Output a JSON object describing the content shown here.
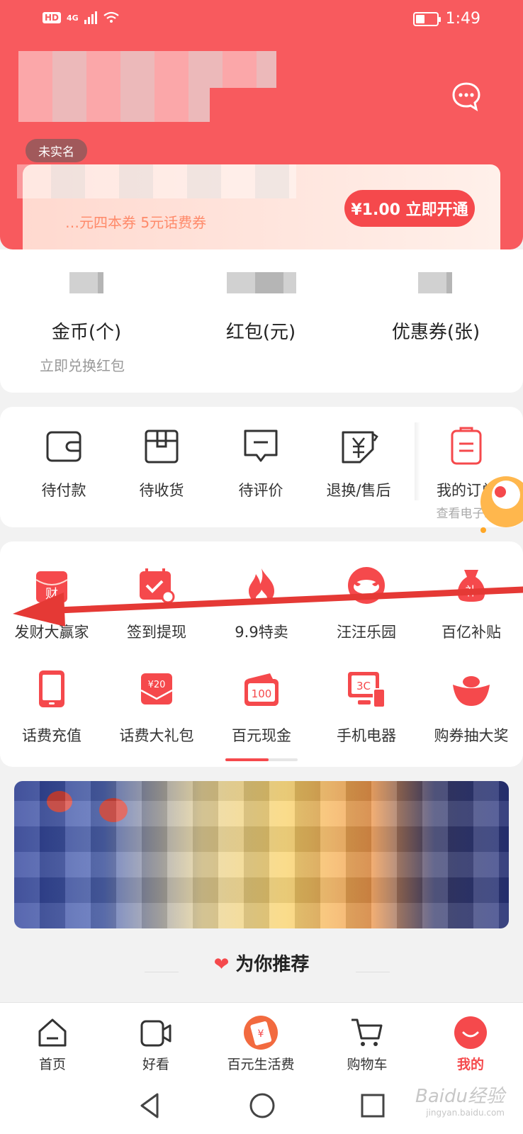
{
  "status_bar": {
    "network": "4G",
    "hd_badge": "HD",
    "time": "1:49"
  },
  "header": {
    "realname_badge": "未实名",
    "vip_subtitle": "…元四本券 5元话费券",
    "open_button": "¥1.00 立即开通"
  },
  "assets": {
    "items": [
      {
        "label": "金币(个)"
      },
      {
        "label": "红包(元)"
      },
      {
        "label": "优惠券(张)"
      }
    ],
    "coins_hint": "立即兑换红包"
  },
  "orders": {
    "items": [
      {
        "label": "待付款",
        "icon": "wallet-icon"
      },
      {
        "label": "待收货",
        "icon": "box-icon"
      },
      {
        "label": "待评价",
        "icon": "comment-icon"
      },
      {
        "label": "退换/售后",
        "icon": "refund-icon"
      },
      {
        "label": "我的订单",
        "icon": "order-list-icon"
      }
    ],
    "my_orders_sub": "查看电子发"
  },
  "services": {
    "items": [
      {
        "label": "发财大赢家",
        "icon": "fortune-icon"
      },
      {
        "label": "签到提现",
        "icon": "calendar-check-icon"
      },
      {
        "label": "9.9特卖",
        "icon": "flame-icon"
      },
      {
        "label": "汪汪乐园",
        "icon": "dog-face-icon"
      },
      {
        "label": "百亿补贴",
        "icon": "money-bag-icon"
      },
      {
        "label": "话费充值",
        "icon": "phone-icon"
      },
      {
        "label": "话费大礼包",
        "icon": "gift-envelope-icon"
      },
      {
        "label": "百元现金",
        "icon": "cash-icon"
      },
      {
        "label": "手机电器",
        "icon": "electronics-icon"
      },
      {
        "label": "购券抽大奖",
        "icon": "gold-ingot-icon"
      }
    ],
    "envelope_value": "¥20",
    "cash_value": "100",
    "electronics_text": "3C",
    "fortune_char": "财",
    "subsidy_char": "补",
    "scroll_progress": 0.6
  },
  "recommend": {
    "title": "为你推荐"
  },
  "tabbar": {
    "tabs": [
      {
        "label": "首页",
        "icon": "home-icon"
      },
      {
        "label": "好看",
        "icon": "video-icon"
      },
      {
        "label": "百元生活费",
        "icon": "living-allowance-icon"
      },
      {
        "label": "购物车",
        "icon": "cart-icon"
      },
      {
        "label": "我的",
        "icon": "profile-icon",
        "active": true
      }
    ]
  },
  "watermark": {
    "text": "Baidu经验",
    "sub": "jingyan.baidu.com"
  },
  "colors": {
    "brand_red": "#f85a5e",
    "accent": "#f5494c"
  }
}
